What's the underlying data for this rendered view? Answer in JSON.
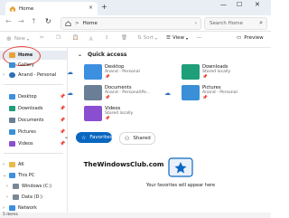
{
  "window": {
    "tab_title": "Home",
    "tab_close": "×",
    "new_tab": "+",
    "minimize": "—",
    "maximize": "☐",
    "close": "✕"
  },
  "address": {
    "back": "←",
    "forward": "→",
    "up": "↑",
    "refresh": "↻",
    "separator": ">",
    "breadcrumb": "Home",
    "breadcrumb_chevron": "›",
    "search_placeholder": "Search Home"
  },
  "commandbar": {
    "new_label": "New",
    "sort_label": "Sort",
    "view_label": "View",
    "more": "···",
    "preview_label": "Preview"
  },
  "sidebar": {
    "items": [
      {
        "label": "Home",
        "icon": "home-icon",
        "color": "#e7a23a"
      },
      {
        "label": "Gallery",
        "icon": "gallery-icon",
        "color": "#3a8fd6"
      },
      {
        "label": "Anand - Personal",
        "icon": "cloud-icon",
        "color": "#2d6fb8"
      },
      {
        "label": "Desktop",
        "icon": "desktop-icon",
        "color": "#3d8fe0"
      },
      {
        "label": "Downloads",
        "icon": "downloads-icon",
        "color": "#1f9e7a"
      },
      {
        "label": "Documents",
        "icon": "documents-icon",
        "color": "#6a7e96"
      },
      {
        "label": "Pictures",
        "icon": "pictures-icon",
        "color": "#3a8fd6"
      },
      {
        "label": "Videos",
        "icon": "videos-icon",
        "color": "#8a4fd0"
      },
      {
        "label": "AK",
        "icon": "folder-icon",
        "color": "#e9b949"
      },
      {
        "label": "This PC",
        "icon": "pc-icon",
        "color": "#3d8fe0"
      },
      {
        "label": "Windows (C:)",
        "icon": "drive-icon",
        "color": "#7a8896"
      },
      {
        "label": "Data (D:)",
        "icon": "drive-icon",
        "color": "#7a8896"
      },
      {
        "label": "Network",
        "icon": "network-icon",
        "color": "#3d8fe0"
      }
    ]
  },
  "quick_access": {
    "heading": "Quick access",
    "items": [
      {
        "name": "Desktop",
        "sub": "Anand - Personal",
        "pin": "📌",
        "color": "#3d8fe0",
        "cloud": true
      },
      {
        "name": "Downloads",
        "sub": "Stored locally",
        "pin": "📌",
        "color": "#1f9e7a",
        "cloud": false
      },
      {
        "name": "Documents",
        "sub": "Anand - Personal\\Pe...",
        "pin": "📌",
        "color": "#6a7e96",
        "cloud": true
      },
      {
        "name": "Pictures",
        "sub": "Anand - Personal",
        "pin": "📌",
        "color": "#3a8fd6",
        "cloud": true
      },
      {
        "name": "Videos",
        "sub": "Stored locally",
        "pin": "📌",
        "color": "#8a4fd0",
        "cloud": false
      }
    ]
  },
  "favorites": {
    "favorites_label": "Favorites",
    "shared_label": "Shared",
    "empty_message": "Your favorites will appear here"
  },
  "watermark": "TheWindowsClub.com",
  "status": {
    "items_count": "5 items"
  },
  "colors": {
    "accent": "#0a67c0",
    "highlight_oval": "#e2463a"
  }
}
